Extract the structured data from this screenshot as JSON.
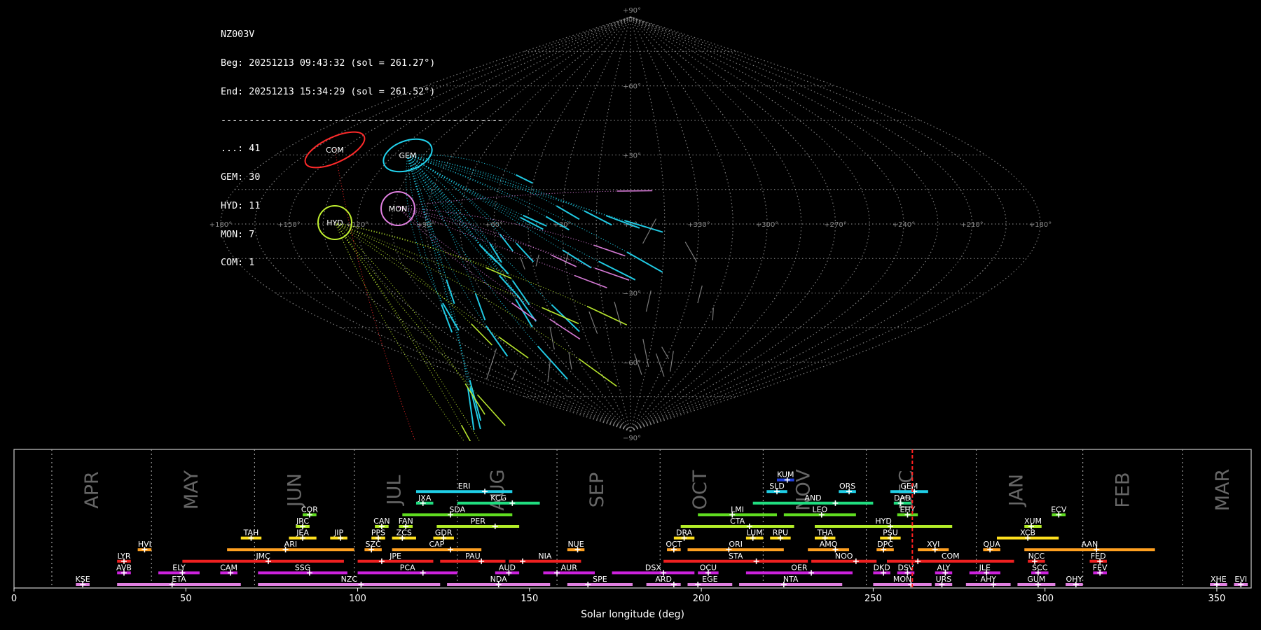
{
  "header": {
    "station": "NZ003V",
    "begin": "Beg: 20251213 09:43:32 (sol = 261.27°)",
    "end": "End: 20251213 15:34:29 (sol = 261.52°)",
    "separator": "--------------------------------------------------",
    "counts": [
      "...: 41",
      "GEM: 30",
      "HYD: 11",
      "MON: 7",
      "COM: 1"
    ]
  },
  "colors": {
    "grid": "#9a9a9a",
    "sporadic": "#9a9a9a",
    "GEM": "#22d3ee",
    "HYD": "#c0f030",
    "MON": "#e080e0",
    "COM": "#ff2a2a",
    "current_sol": "#ff2020",
    "month_label": "#666666",
    "panel_border": "#cccccc"
  },
  "chart_data": [
    {
      "type": "scatter",
      "projection": "sinusoidal",
      "lon_ticks": [
        "+180°",
        "+150°",
        "+120°",
        "+90°",
        "+60°",
        "+30°",
        "+0°",
        "+330°",
        "+300°",
        "+270°",
        "+240°",
        "+210°",
        "+180°"
      ],
      "lat_ticks": [
        {
          "lat": 90,
          "label": "+90°"
        },
        {
          "lat": 60,
          "label": "+60°"
        },
        {
          "lat": 30,
          "label": "+30°"
        },
        {
          "lat": -30,
          "label": "−30°"
        },
        {
          "lat": -60,
          "label": "−60°"
        },
        {
          "lat": -90,
          "label": "−90°"
        }
      ],
      "radiants": [
        {
          "code": "COM",
          "lon": 160,
          "lat": 33,
          "color": "#ff2a2a"
        },
        {
          "code": "GEM",
          "lon": 112,
          "lat": 32,
          "color": "#22d3ee"
        },
        {
          "code": "MON",
          "lon": 100,
          "lat": 8,
          "color": "#e080e0"
        },
        {
          "code": "HYD",
          "lon": 128,
          "lat": 0,
          "color": "#c0f030"
        }
      ]
    },
    {
      "type": "bar",
      "xlabel": "Solar longitude (deg)",
      "xlim": [
        0,
        360
      ],
      "x_ticks": [
        0,
        50,
        100,
        150,
        200,
        250,
        300,
        350
      ],
      "months": [
        {
          "name": "APR",
          "start": 11
        },
        {
          "name": "MAY",
          "start": 40
        },
        {
          "name": "JUN",
          "start": 70
        },
        {
          "name": "JUL",
          "start": 99
        },
        {
          "name": "AUG",
          "start": 129
        },
        {
          "name": "SEP",
          "start": 158
        },
        {
          "name": "OCT",
          "start": 188
        },
        {
          "name": "NOV",
          "start": 218
        },
        {
          "name": "DEC",
          "start": 248
        },
        {
          "name": "JAN",
          "start": 280
        },
        {
          "name": "FEB",
          "start": 311
        },
        {
          "name": "MAR",
          "start": 340
        }
      ],
      "current_sol": 261.4,
      "showers": [
        {
          "code": "KSE",
          "start": 18,
          "end": 22,
          "peak": 20,
          "row": 1,
          "color": "#e080e0"
        },
        {
          "code": "ETA",
          "start": 30,
          "end": 66,
          "peak": 46,
          "row": 1,
          "color": "#e080e0"
        },
        {
          "code": "NZC",
          "start": 71,
          "end": 124,
          "peak": 101,
          "row": 1,
          "color": "#e080e0"
        },
        {
          "code": "NDA",
          "start": 126,
          "end": 156,
          "peak": 141,
          "row": 1,
          "color": "#e080e0"
        },
        {
          "code": "SPE",
          "start": 161,
          "end": 180,
          "peak": 167,
          "row": 1,
          "color": "#e080e0"
        },
        {
          "code": "ARD",
          "start": 184,
          "end": 194,
          "peak": 192,
          "row": 1,
          "color": "#e080e0"
        },
        {
          "code": "EGE",
          "start": 196,
          "end": 209,
          "peak": 199,
          "row": 1,
          "color": "#e080e0"
        },
        {
          "code": "NTA",
          "start": 211,
          "end": 241,
          "peak": 224,
          "row": 1,
          "color": "#e080e0"
        },
        {
          "code": "MON",
          "start": 250,
          "end": 267,
          "peak": 261,
          "row": 1,
          "color": "#e080e0"
        },
        {
          "code": "URS",
          "start": 268,
          "end": 273,
          "peak": 270,
          "row": 1,
          "color": "#e080e0"
        },
        {
          "code": "AHY",
          "start": 277,
          "end": 290,
          "peak": 285,
          "row": 1,
          "color": "#e080e0"
        },
        {
          "code": "GUM",
          "start": 292,
          "end": 303,
          "peak": 298,
          "row": 1,
          "color": "#e080e0"
        },
        {
          "code": "OHY",
          "start": 306,
          "end": 311,
          "peak": 309,
          "row": 1,
          "color": "#e080e0"
        },
        {
          "code": "XHE",
          "start": 348,
          "end": 353,
          "peak": 350,
          "row": 1,
          "color": "#e080e0"
        },
        {
          "code": "EVI",
          "start": 355,
          "end": 359,
          "peak": 357,
          "row": 1,
          "color": "#e080e0"
        },
        {
          "code": "AVB",
          "start": 30,
          "end": 34,
          "peak": 32,
          "row": 2,
          "color": "#cc22dd"
        },
        {
          "code": "ELY",
          "start": 42,
          "end": 54,
          "peak": 49,
          "row": 2,
          "color": "#cc22dd"
        },
        {
          "code": "CAM",
          "start": 60,
          "end": 65,
          "peak": 63,
          "row": 2,
          "color": "#cc22dd"
        },
        {
          "code": "SSG",
          "start": 71,
          "end": 97,
          "peak": 86,
          "row": 2,
          "color": "#cc22dd"
        },
        {
          "code": "PCA",
          "start": 100,
          "end": 129,
          "peak": 119,
          "row": 2,
          "color": "#cc22dd"
        },
        {
          "code": "AUD",
          "start": 140,
          "end": 147,
          "peak": 144,
          "row": 2,
          "color": "#cc22dd"
        },
        {
          "code": "AUR",
          "start": 154,
          "end": 169,
          "peak": 158,
          "row": 2,
          "color": "#cc22dd"
        },
        {
          "code": "DSX",
          "start": 174,
          "end": 198,
          "peak": 189,
          "row": 2,
          "color": "#cc22dd"
        },
        {
          "code": "OCU",
          "start": 199,
          "end": 205,
          "peak": 202,
          "row": 2,
          "color": "#cc22dd"
        },
        {
          "code": "OER",
          "start": 213,
          "end": 244,
          "peak": 232,
          "row": 2,
          "color": "#cc22dd"
        },
        {
          "code": "DKD",
          "start": 250,
          "end": 255,
          "peak": 253,
          "row": 2,
          "color": "#cc22dd"
        },
        {
          "code": "DSV",
          "start": 257,
          "end": 262,
          "peak": 260,
          "row": 2,
          "color": "#cc22dd"
        },
        {
          "code": "ALY",
          "start": 268,
          "end": 273,
          "peak": 271,
          "row": 2,
          "color": "#cc22dd"
        },
        {
          "code": "JLE",
          "start": 278,
          "end": 287,
          "peak": 283,
          "row": 2,
          "color": "#cc22dd"
        },
        {
          "code": "SCC",
          "start": 296,
          "end": 301,
          "peak": 298,
          "row": 2,
          "color": "#cc22dd"
        },
        {
          "code": "FEV",
          "start": 314,
          "end": 318,
          "peak": 316,
          "row": 2,
          "color": "#cc22dd"
        },
        {
          "code": "LYR",
          "start": 30,
          "end": 34,
          "peak": 32,
          "row": 3,
          "color": "#ee2020"
        },
        {
          "code": "JMC",
          "start": 49,
          "end": 96,
          "peak": 74,
          "row": 3,
          "color": "#ee2020"
        },
        {
          "code": "JPE",
          "start": 100,
          "end": 122,
          "peak": 107,
          "row": 3,
          "color": "#ee2020"
        },
        {
          "code": "PAU",
          "start": 124,
          "end": 143,
          "peak": 136,
          "row": 3,
          "color": "#ee2020"
        },
        {
          "code": "NIA",
          "start": 144,
          "end": 165,
          "peak": 148,
          "row": 3,
          "color": "#ee2020"
        },
        {
          "code": "STA",
          "start": 189,
          "end": 231,
          "peak": 216,
          "row": 3,
          "color": "#ee2020"
        },
        {
          "code": "NOO",
          "start": 232,
          "end": 251,
          "peak": 245,
          "row": 3,
          "color": "#ee2020"
        },
        {
          "code": "COM",
          "start": 254,
          "end": 291,
          "peak": 263,
          "row": 3,
          "color": "#ee2020"
        },
        {
          "code": "NCC",
          "start": 295,
          "end": 300,
          "peak": 297,
          "row": 3,
          "color": "#ee2020"
        },
        {
          "code": "FED",
          "start": 313,
          "end": 318,
          "peak": 316,
          "row": 3,
          "color": "#ee2020"
        },
        {
          "code": "HVI",
          "start": 36,
          "end": 40,
          "peak": 38,
          "row": 4,
          "color": "#ffa020"
        },
        {
          "code": "ARI",
          "start": 62,
          "end": 99,
          "peak": 79,
          "row": 4,
          "color": "#ffa020"
        },
        {
          "code": "SZC",
          "start": 102,
          "end": 107,
          "peak": 104,
          "row": 4,
          "color": "#ffa020"
        },
        {
          "code": "CAP",
          "start": 110,
          "end": 136,
          "peak": 127,
          "row": 4,
          "color": "#ffa020"
        },
        {
          "code": "NUE",
          "start": 161,
          "end": 166,
          "peak": 164,
          "row": 4,
          "color": "#ffa020"
        },
        {
          "code": "OCT",
          "start": 190,
          "end": 194,
          "peak": 192,
          "row": 4,
          "color": "#ffa020"
        },
        {
          "code": "ORI",
          "start": 196,
          "end": 224,
          "peak": 208,
          "row": 4,
          "color": "#ffa020"
        },
        {
          "code": "AMO",
          "start": 231,
          "end": 243,
          "peak": 239,
          "row": 4,
          "color": "#ffa020"
        },
        {
          "code": "DPC",
          "start": 251,
          "end": 256,
          "peak": 253,
          "row": 4,
          "color": "#ffa020"
        },
        {
          "code": "XVI",
          "start": 263,
          "end": 272,
          "peak": 268,
          "row": 4,
          "color": "#ffa020"
        },
        {
          "code": "QUA",
          "start": 282,
          "end": 287,
          "peak": 284,
          "row": 4,
          "color": "#ffa020"
        },
        {
          "code": "AAN",
          "start": 294,
          "end": 332,
          "peak": 315,
          "row": 4,
          "color": "#ffa020"
        },
        {
          "code": "TAH",
          "start": 66,
          "end": 72,
          "peak": 69,
          "row": 5,
          "color": "#ffe01e"
        },
        {
          "code": "JEA",
          "start": 80,
          "end": 88,
          "peak": 84,
          "row": 5,
          "color": "#ffe01e"
        },
        {
          "code": "JIP",
          "start": 92,
          "end": 97,
          "peak": 95,
          "row": 5,
          "color": "#ffe01e"
        },
        {
          "code": "PPS",
          "start": 104,
          "end": 108,
          "peak": 106,
          "row": 5,
          "color": "#ffe01e"
        },
        {
          "code": "ZCS",
          "start": 110,
          "end": 117,
          "peak": 113,
          "row": 5,
          "color": "#ffe01e"
        },
        {
          "code": "GDR",
          "start": 122,
          "end": 128,
          "peak": 125,
          "row": 5,
          "color": "#ffe01e"
        },
        {
          "code": "DRA",
          "start": 192,
          "end": 198,
          "peak": 195,
          "row": 5,
          "color": "#ffe01e"
        },
        {
          "code": "LUM",
          "start": 213,
          "end": 218,
          "peak": 215,
          "row": 5,
          "color": "#ffe01e"
        },
        {
          "code": "RPU",
          "start": 220,
          "end": 226,
          "peak": 223,
          "row": 5,
          "color": "#ffe01e"
        },
        {
          "code": "THA",
          "start": 233,
          "end": 239,
          "peak": 236,
          "row": 5,
          "color": "#ffe01e"
        },
        {
          "code": "PSU",
          "start": 252,
          "end": 258,
          "peak": 255,
          "row": 5,
          "color": "#ffe01e"
        },
        {
          "code": "XCB",
          "start": 286,
          "end": 304,
          "peak": 295,
          "row": 5,
          "color": "#ffe01e"
        },
        {
          "code": "JRC",
          "start": 82,
          "end": 86,
          "peak": 84,
          "row": 6,
          "color": "#b4ee28"
        },
        {
          "code": "CAN",
          "start": 105,
          "end": 109,
          "peak": 107,
          "row": 6,
          "color": "#b4ee28"
        },
        {
          "code": "FAN",
          "start": 112,
          "end": 116,
          "peak": 114,
          "row": 6,
          "color": "#b4ee28"
        },
        {
          "code": "PER",
          "start": 123,
          "end": 147,
          "peak": 140,
          "row": 6,
          "color": "#b4ee28"
        },
        {
          "code": "CTA",
          "start": 194,
          "end": 227,
          "peak": 214,
          "row": 6,
          "color": "#b4ee28"
        },
        {
          "code": "HYD",
          "start": 233,
          "end": 273,
          "peak": 255,
          "row": 6,
          "color": "#b4ee28"
        },
        {
          "code": "XUM",
          "start": 294,
          "end": 299,
          "peak": 296,
          "row": 6,
          "color": "#b4ee28"
        },
        {
          "code": "COR",
          "start": 84,
          "end": 88,
          "peak": 86,
          "row": 7,
          "color": "#60dd20"
        },
        {
          "code": "SDA",
          "start": 113,
          "end": 145,
          "peak": 127,
          "row": 7,
          "color": "#60dd20"
        },
        {
          "code": "LMI",
          "start": 199,
          "end": 222,
          "peak": 209,
          "row": 7,
          "color": "#60dd20"
        },
        {
          "code": "LEO",
          "start": 224,
          "end": 245,
          "peak": 235,
          "row": 7,
          "color": "#60dd20"
        },
        {
          "code": "EHY",
          "start": 257,
          "end": 263,
          "peak": 260,
          "row": 7,
          "color": "#60dd20"
        },
        {
          "code": "ECV",
          "start": 302,
          "end": 306,
          "peak": 304,
          "row": 7,
          "color": "#60dd20"
        },
        {
          "code": "JXA",
          "start": 117,
          "end": 122,
          "peak": 119,
          "row": 8,
          "color": "#20dd80"
        },
        {
          "code": "KCG",
          "start": 129,
          "end": 153,
          "peak": 145,
          "row": 8,
          "color": "#20dd80"
        },
        {
          "code": "AND",
          "start": 215,
          "end": 250,
          "peak": 239,
          "row": 8,
          "color": "#20dd80"
        },
        {
          "code": "DAD",
          "start": 256,
          "end": 261,
          "peak": 258,
          "row": 8,
          "color": "#20dd80"
        },
        {
          "code": "ERI",
          "start": 117,
          "end": 145,
          "peak": 137,
          "row": 9,
          "color": "#20d0e8"
        },
        {
          "code": "SLD",
          "start": 219,
          "end": 225,
          "peak": 222,
          "row": 9,
          "color": "#20d0e8"
        },
        {
          "code": "ORS",
          "start": 240,
          "end": 245,
          "peak": 243,
          "row": 9,
          "color": "#20d0e8"
        },
        {
          "code": "GEM",
          "start": 255,
          "end": 266,
          "peak": 262,
          "row": 9,
          "color": "#20d0e8"
        },
        {
          "code": "KUM",
          "start": 222,
          "end": 227,
          "peak": 225,
          "row": 10,
          "color": "#2040e0"
        }
      ]
    }
  ]
}
